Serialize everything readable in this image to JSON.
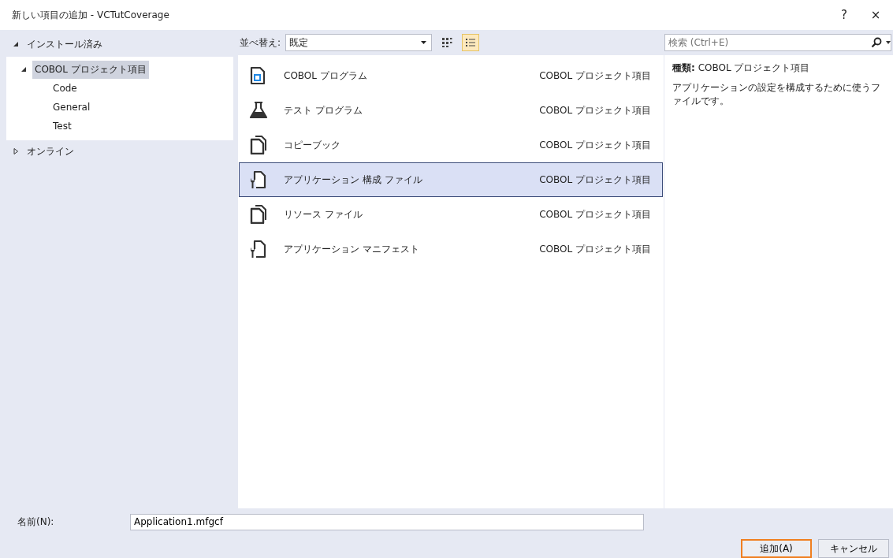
{
  "window": {
    "title": "新しい項目の追加 - VCTutCoverage",
    "help": "?",
    "close": "×"
  },
  "tree": [
    {
      "label": "インストール済み",
      "expanded": true,
      "selected": false,
      "children": [
        {
          "label": "COBOL プロジェクト項目",
          "expanded": true,
          "selected": true,
          "children": [
            {
              "label": "Code",
              "selected": false
            },
            {
              "label": "General",
              "selected": false
            },
            {
              "label": "Test",
              "selected": false
            }
          ]
        }
      ]
    },
    {
      "label": "オンライン",
      "expanded": false,
      "selected": false
    }
  ],
  "sort": {
    "label": "並べ替え:",
    "value": "既定"
  },
  "view_buttons": [
    {
      "kind": "grid",
      "selected": false
    },
    {
      "kind": "list",
      "selected": true
    }
  ],
  "search": {
    "placeholder": "検索 (Ctrl+E)"
  },
  "templates": [
    {
      "kind": "program",
      "name": "COBOL プログラム",
      "type": "COBOL プロジェクト項目",
      "selected": false
    },
    {
      "kind": "flask",
      "name": "テスト プログラム",
      "type": "COBOL プロジェクト項目",
      "selected": false
    },
    {
      "kind": "pages",
      "name": "コピーブック",
      "type": "COBOL プロジェクト項目",
      "selected": false
    },
    {
      "kind": "config",
      "name": "アプリケーション 構成 ファイル",
      "type": "COBOL プロジェクト項目",
      "selected": true
    },
    {
      "kind": "pages",
      "name": "リソース ファイル",
      "type": "COBOL プロジェクト項目",
      "selected": false
    },
    {
      "kind": "config",
      "name": "アプリケーション マニフェスト",
      "type": "COBOL プロジェクト項目",
      "selected": false
    }
  ],
  "details": {
    "type": "**種類:** COBOL プロジェクト項目",
    "description": "アプリケーションの設定を構成するために使うファイルです。"
  },
  "name_field": {
    "label": "名前(N):",
    "value": "Application1.mfgcf"
  },
  "buttons": [
    {
      "label": "追加(A)",
      "kind": "primary"
    },
    {
      "label": "キャンセル",
      "kind": "normal"
    }
  ]
}
